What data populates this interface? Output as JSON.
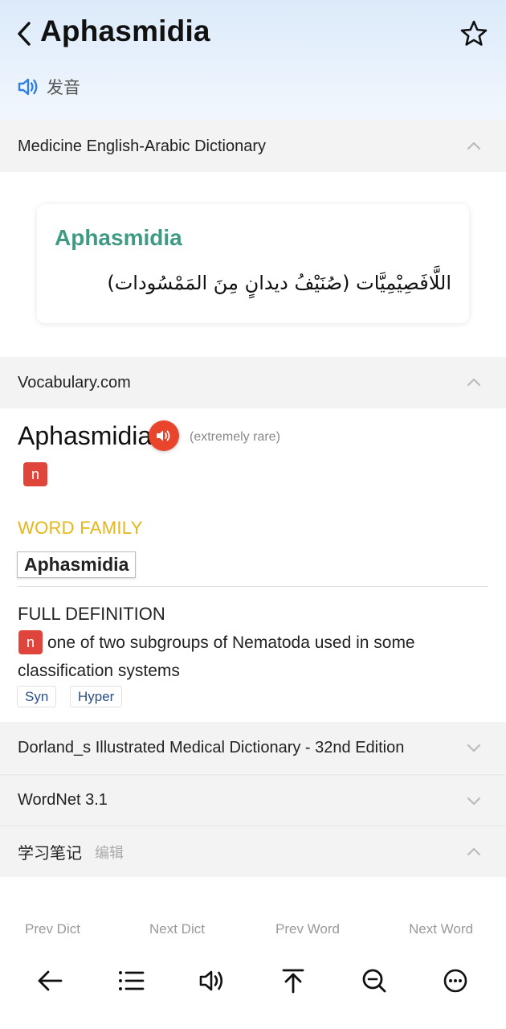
{
  "header": {
    "title": "Aphasmidia",
    "pronunciation_label": "发音"
  },
  "sections": {
    "medicine": {
      "title": "Medicine English-Arabic Dictionary",
      "expanded": true
    },
    "vocabulary": {
      "title": "Vocabulary.com",
      "expanded": true
    },
    "dorland": {
      "title": "Dorland_s Illustrated Medical Dictionary - 32nd Edition",
      "expanded": false
    },
    "wordnet": {
      "title": "WordNet 3.1",
      "expanded": false
    },
    "notes": {
      "title": "学习笔记",
      "edit_label": "编辑",
      "expanded": true
    }
  },
  "medicine_card": {
    "word": "Aphasmidia",
    "definition": "اللَّافَصِيْمِيَّات (صُنَيْفُ ديدانٍ مِنَ المَمْسُودات)"
  },
  "vocabulary_entry": {
    "word": "Aphasmidia",
    "rarity": "(extremely rare)",
    "pos": "n",
    "word_family_label": "WORD FAMILY",
    "word_family_word": "Aphasmidia",
    "full_definition_label": "FULL DEFINITION",
    "definition_pos": "n",
    "definition": "one of two subgroups of Nematoda used in some classification systems",
    "tags": [
      "Syn",
      "Hyper"
    ]
  },
  "bottom_nav": {
    "prev_dict": "Prev Dict",
    "next_dict": "Next Dict",
    "prev_word": "Prev Word",
    "next_word": "Next Word"
  },
  "toolbar_icons": [
    "back-arrow-icon",
    "list-icon",
    "speaker-icon",
    "scroll-top-icon",
    "search-zoom-icon",
    "more-icon"
  ],
  "colors": {
    "accent_green": "#3f9a84",
    "badge_red": "#e0453b",
    "speaker_orange": "#e8452c",
    "family_yellow": "#e6b619",
    "pron_blue": "#2f7fe0"
  }
}
